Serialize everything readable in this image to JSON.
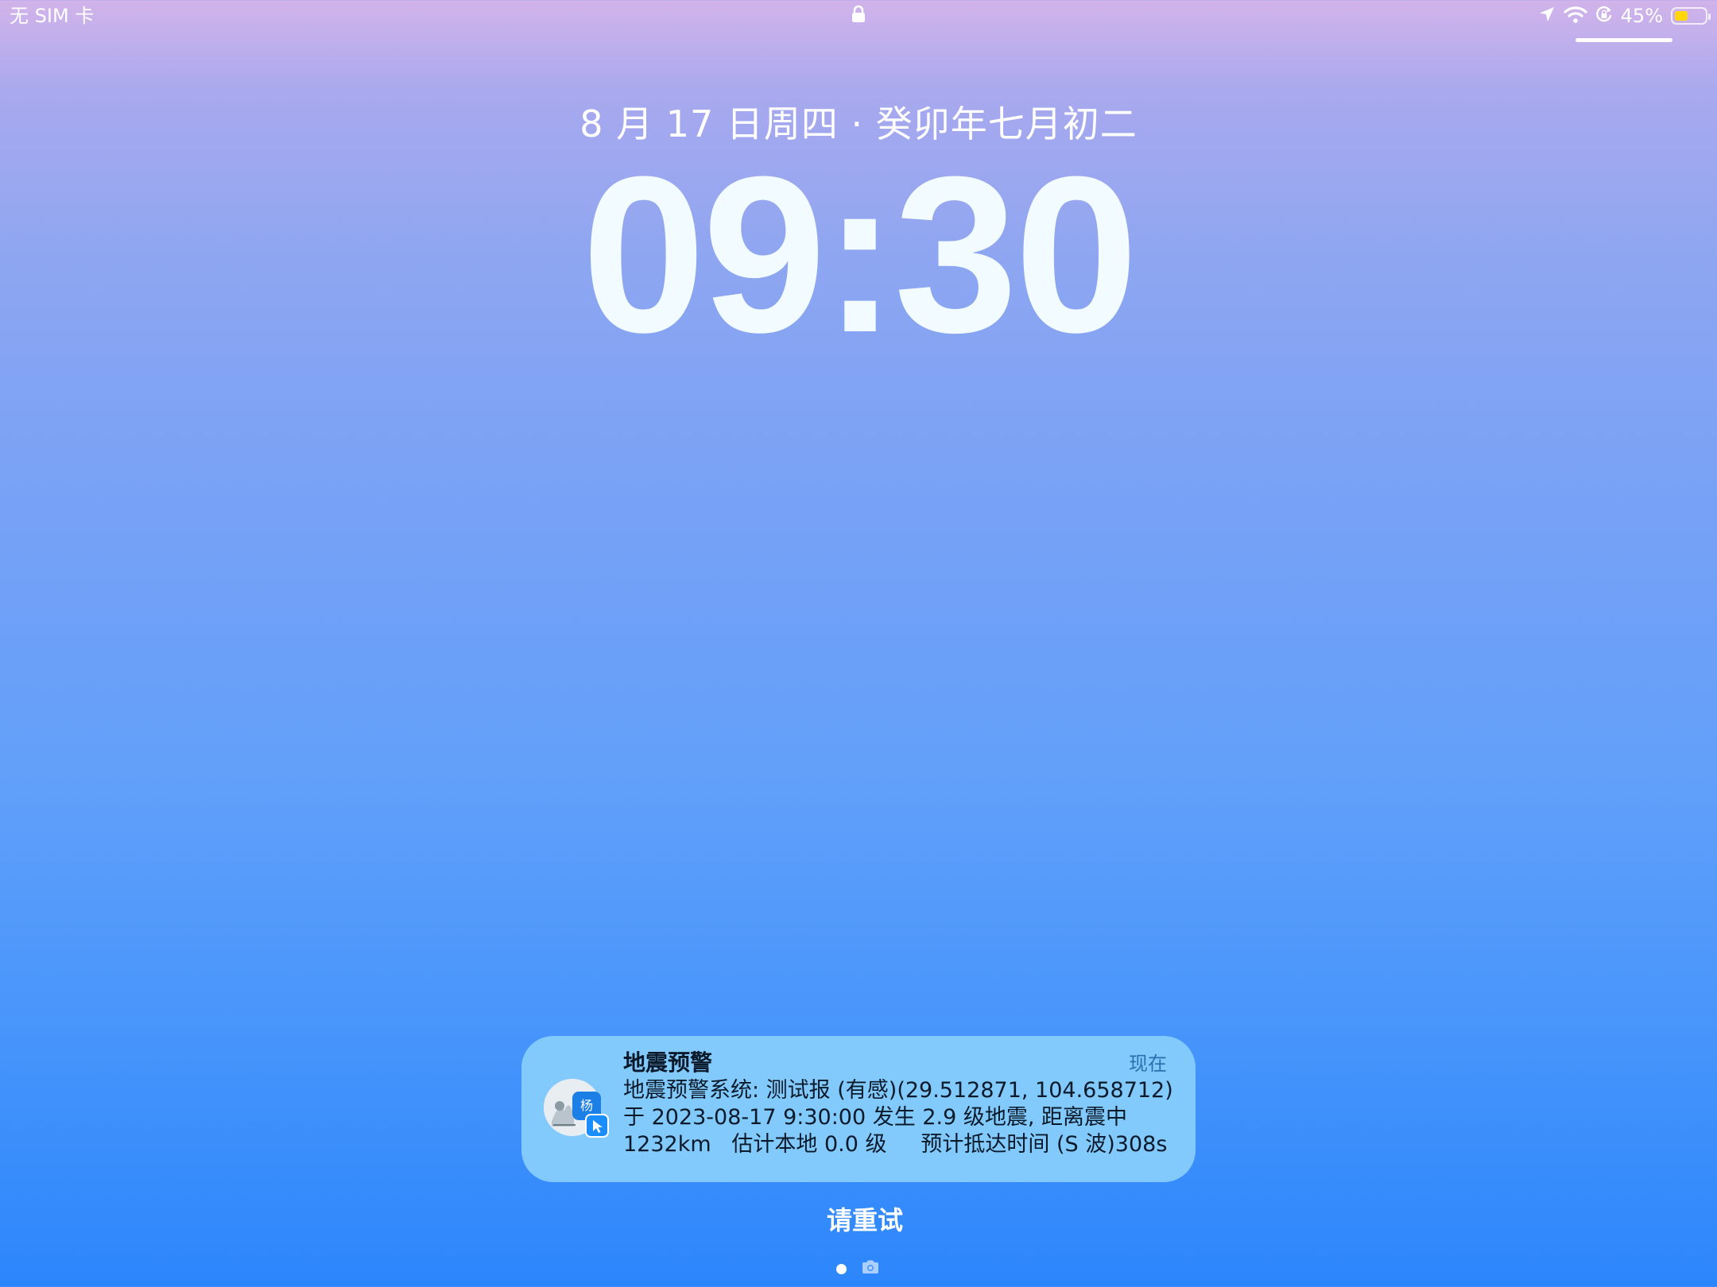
{
  "status_bar": {
    "carrier": "无 SIM 卡",
    "battery_percent": "45%",
    "battery_level": 0.45,
    "icons": [
      "lock-icon",
      "location-icon",
      "wifi-icon",
      "orientation-lock-icon",
      "battery-icon"
    ]
  },
  "lockscreen": {
    "date": "8 月 17 日周四 · 癸卯年七月初二",
    "time": "09:30"
  },
  "notification": {
    "title": "地震预警",
    "time": "现在",
    "avatar_badge": "杨",
    "body_lines": [
      "地震预警系统: 测试报 (有感)(29.512871, 104.658712)",
      "于 2023-08-17 9:30:00 发生 2.9 级地震, 距离震中",
      "1232km   估计本地 0.0 级     预计抵达时间 (S 波)308s"
    ]
  },
  "bottom": {
    "retry_label": "请重试",
    "page_icons": [
      "page-dot",
      "camera-icon"
    ]
  },
  "colors": {
    "battery_fill": "#ffd60a",
    "notification_bg": "#8cd2fc"
  }
}
